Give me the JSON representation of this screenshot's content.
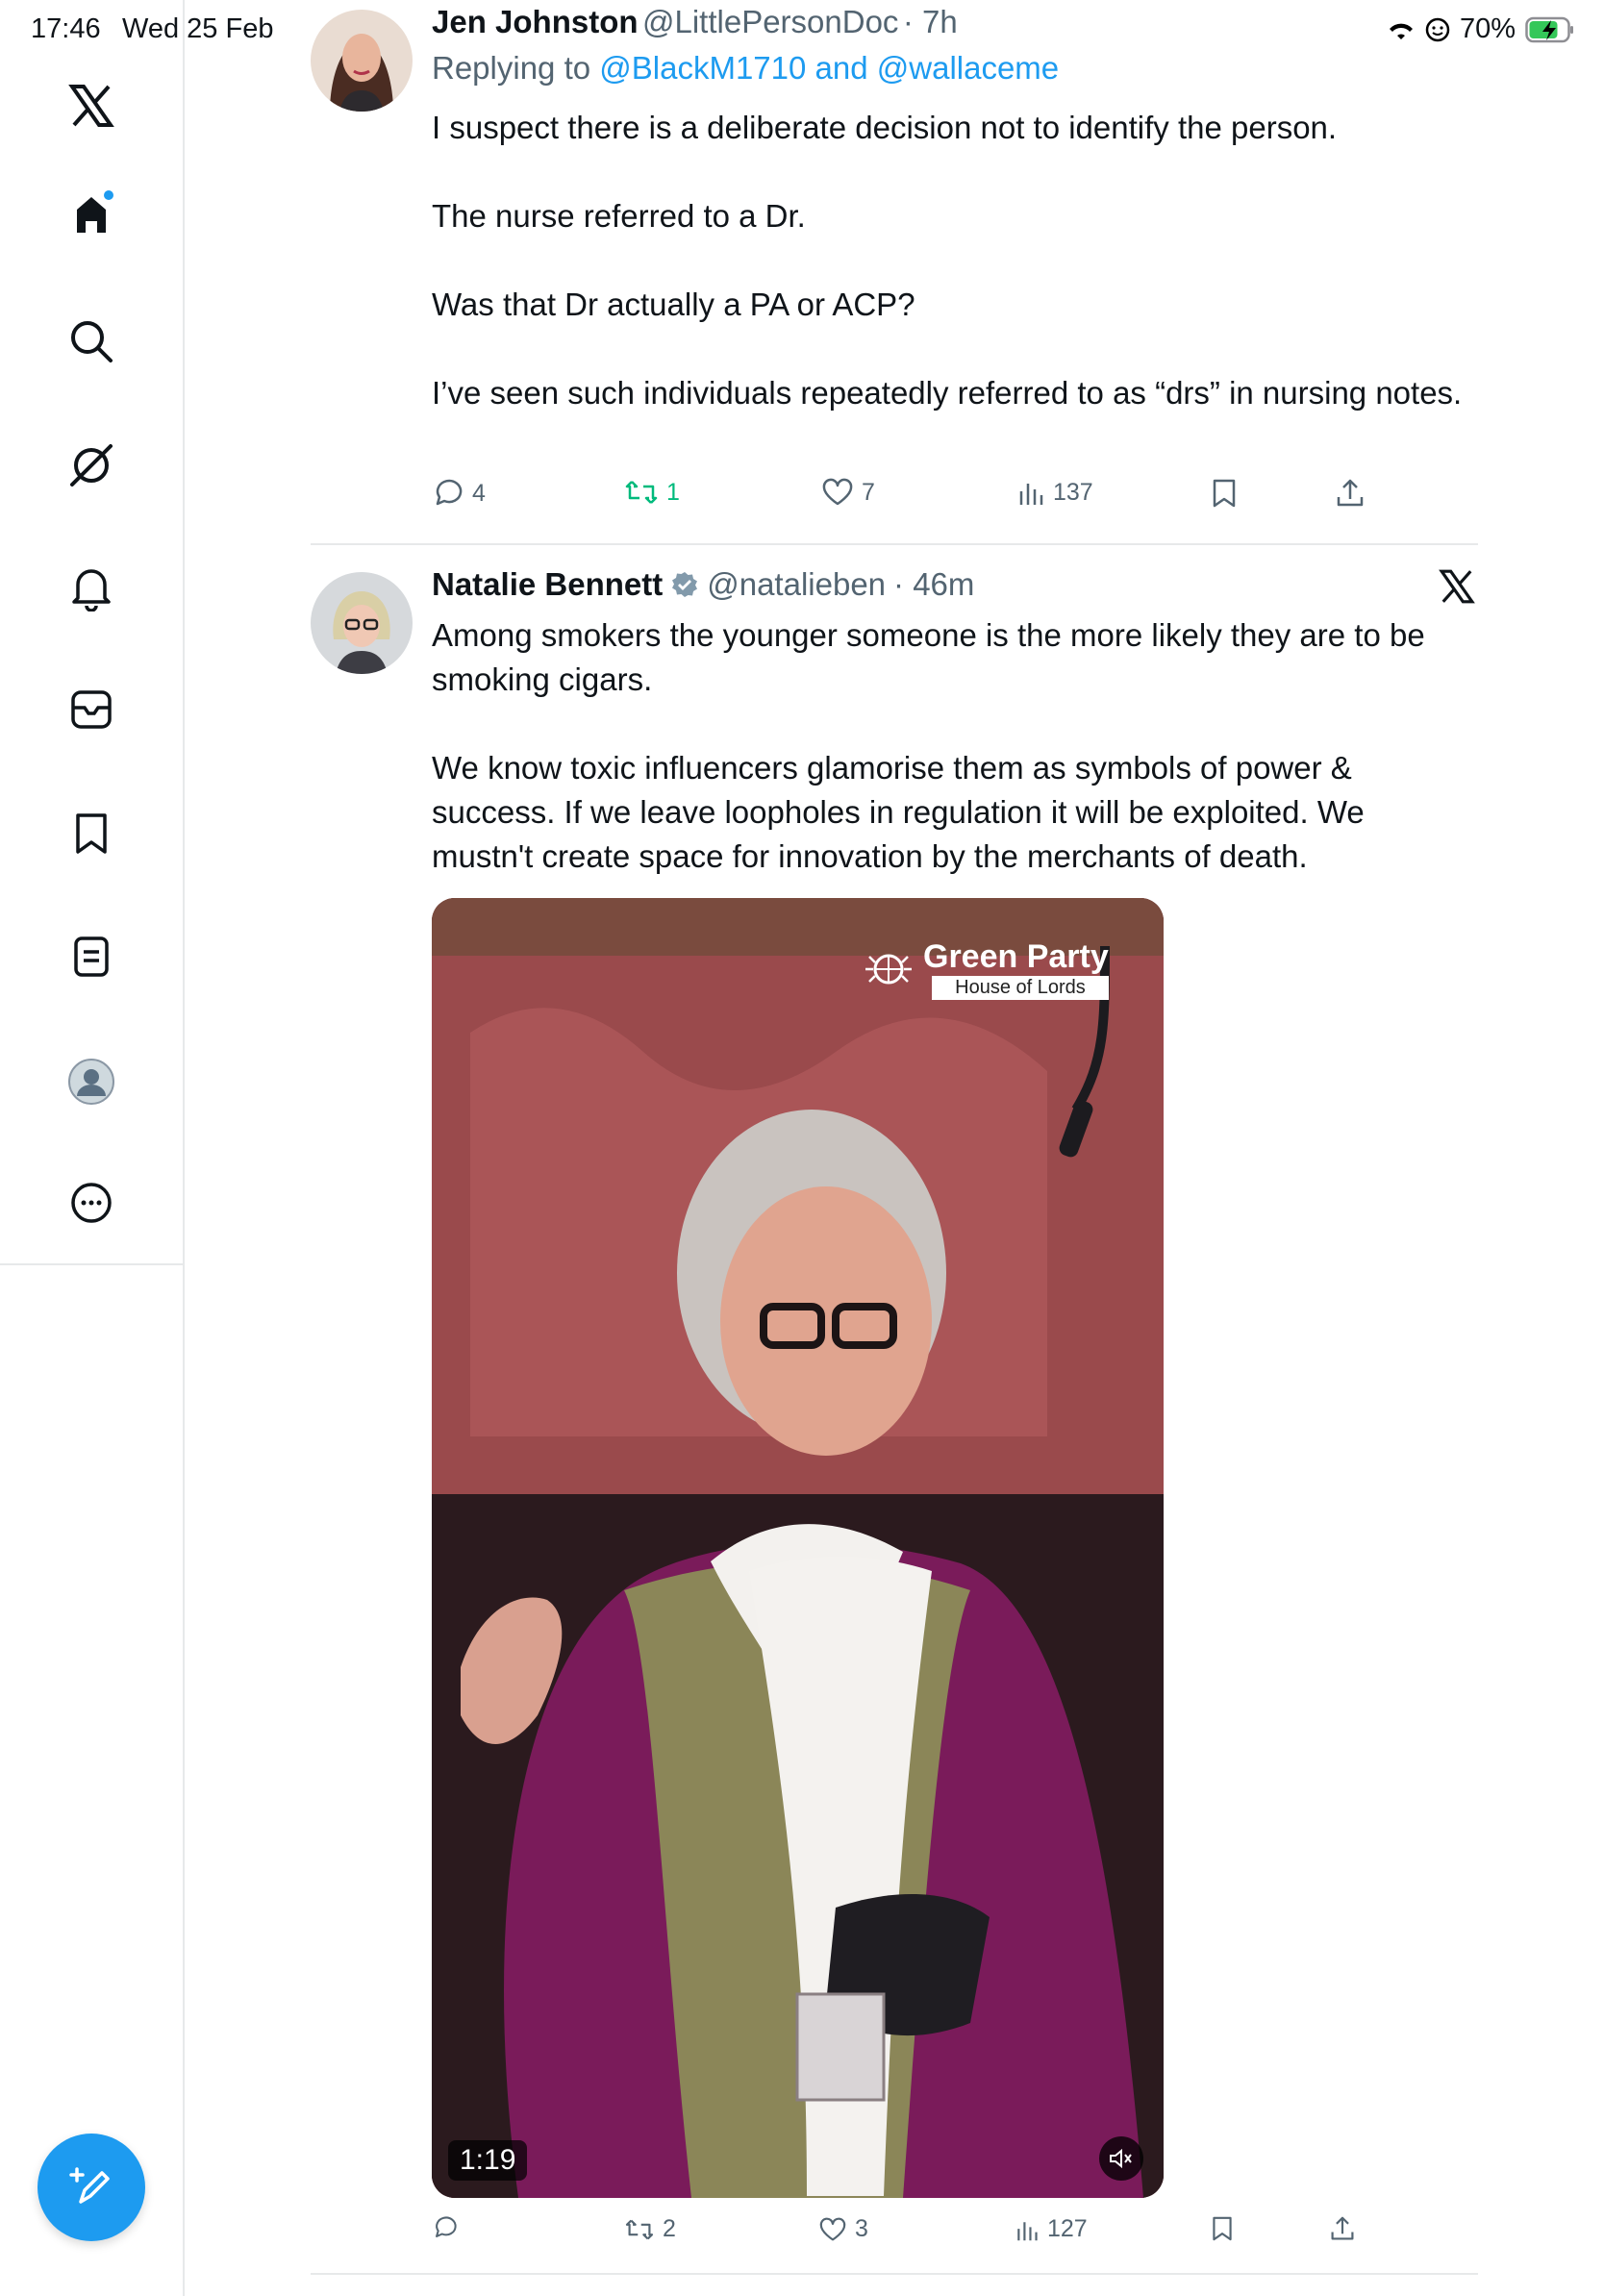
{
  "status_bar": {
    "time": "17:46",
    "date": "Wed 25 Feb",
    "battery": "70%"
  },
  "sidebar": {
    "items": [
      {
        "name": "x-logo-icon"
      },
      {
        "name": "home-icon"
      },
      {
        "name": "search-icon"
      },
      {
        "name": "grok-icon"
      },
      {
        "name": "notifications-icon"
      },
      {
        "name": "messages-icon"
      },
      {
        "name": "bookmarks-icon"
      },
      {
        "name": "lists-icon"
      },
      {
        "name": "profile-icon"
      },
      {
        "name": "more-icon"
      }
    ],
    "compose_icon": "compose-icon"
  },
  "tweets": [
    {
      "name": "Jen Johnston",
      "handle": "@LittlePersonDoc",
      "time": "· 7h",
      "replying_prefix": "Replying to ",
      "replying_to": "@BlackM1710 and @wallaceme",
      "text": "I suspect there is a deliberate decision not to identify the person.\n\nThe nurse referred to a Dr.\n\nWas that Dr actually a PA or ACP?\n\nI’ve seen such individuals repeatedly referred to as “drs” in nursing notes.",
      "replies": "4",
      "reposts": "1",
      "likes": "7",
      "views": "137"
    },
    {
      "name": "Natalie Bennett",
      "handle": "@natalieben",
      "time": "· 46m",
      "text": "Among smokers the younger someone is the more likely they are to be smoking cigars.\n\nWe know toxic influencers glamorise them as symbols of power & success. If we leave loopholes in regulation it will be exploited. We mustn't create space for innovation by the merchants of death.",
      "video_overlay_title": "Green Party",
      "video_overlay_subtitle": "House of Lords",
      "video_duration": "1:19",
      "replies": "",
      "reposts": "2",
      "likes": "3",
      "views": "127"
    }
  ],
  "colors": {
    "accent": "#1d9bf0",
    "repost_active": "#00ba7c",
    "muted": "#536471"
  }
}
